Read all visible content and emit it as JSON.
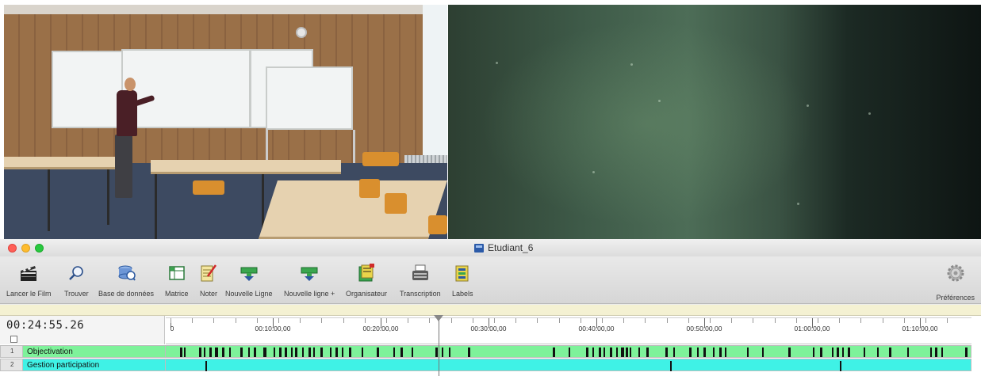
{
  "window": {
    "title": "Etudiant_6"
  },
  "toolbar": {
    "items": [
      {
        "label": "Lancer le Film",
        "icon": "clapperboard-icon"
      },
      {
        "label": "Trouver",
        "icon": "magnifier-icon"
      },
      {
        "label": "Base de données",
        "icon": "database-icon"
      },
      {
        "label": "Matrice",
        "icon": "matrix-icon"
      },
      {
        "label": "Noter",
        "icon": "notepad-pencil-icon"
      },
      {
        "label": "Nouvelle Ligne",
        "icon": "new-line-icon"
      },
      {
        "label": "Nouvelle ligne +",
        "icon": "new-line-plus-icon"
      },
      {
        "label": "Organisateur",
        "icon": "organizer-icon"
      },
      {
        "label": "Transcription",
        "icon": "typewriter-icon"
      },
      {
        "label": "Labels",
        "icon": "labels-icon"
      }
    ],
    "preferences_label": "Préférences"
  },
  "timeline": {
    "timecode": "00:24:55.26",
    "ruler_labels": [
      "0",
      "00:10:00,00",
      "00:20:00,00",
      "00:30:00,00",
      "00:40:00,00",
      "00:50:00,00",
      "01:00:00,00",
      "01:10:00,00"
    ],
    "tracks": [
      {
        "number": "1",
        "name": "Objectivation",
        "color": "#7ef29a"
      },
      {
        "number": "2",
        "name": "Gestion participation",
        "color": "#3ff2e6"
      }
    ]
  },
  "colors": {
    "track1": "#7ef29a",
    "track2": "#3ff2e6",
    "close": "#ff5f57",
    "minimize": "#febc2e",
    "zoom": "#28c840"
  }
}
